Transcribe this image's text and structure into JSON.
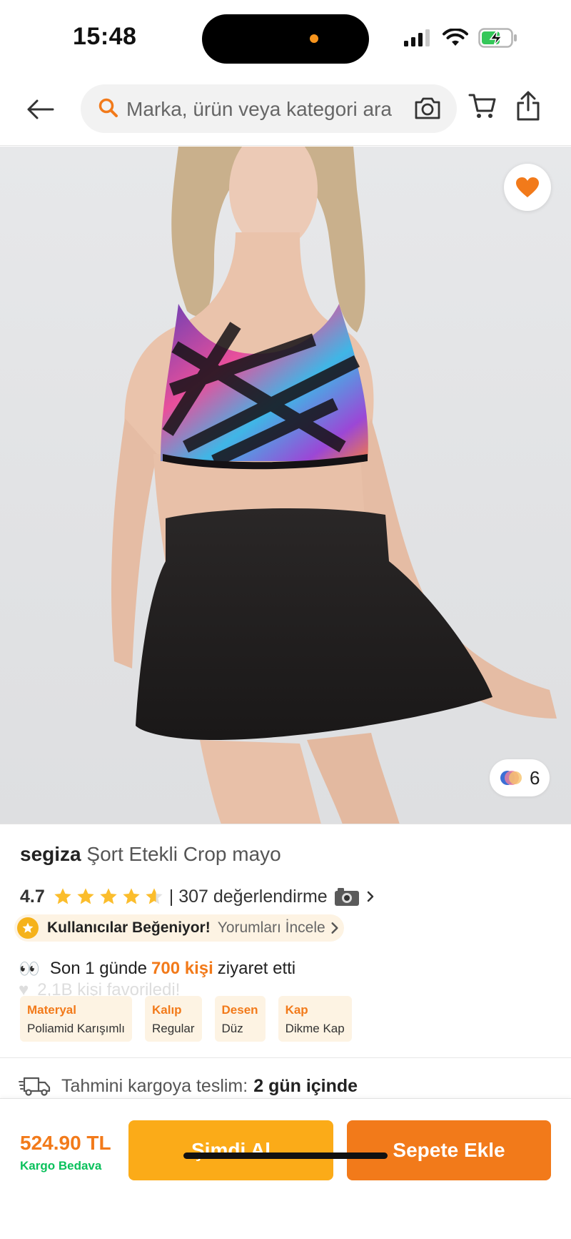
{
  "status_bar": {
    "time": "15:48"
  },
  "header": {
    "search_placeholder": "Marka, ürün veya kategori ara"
  },
  "product": {
    "brand": "segiza",
    "name": "Şort Etekli Crop mayo",
    "color_count": "6",
    "rating": "4.7",
    "stars": 4.5,
    "reviews_text": "| 307 değerlendirme",
    "liked_text": "Kullanıcılar Beğeniyor!",
    "liked_link": "Yorumları İncele",
    "visit_prefix": "Son 1 günde",
    "visit_highlight": "700 kişi",
    "visit_suffix": "ziyaret etti",
    "favorites_ghost": "2,1B kişi favoriledi!",
    "attributes": [
      {
        "key": "Materyal",
        "value": "Poliamid Karışımlı"
      },
      {
        "key": "Kalıp",
        "value": "Regular"
      },
      {
        "key": "Desen",
        "value": "Düz"
      },
      {
        "key": "Kap",
        "value": "Dikme Kap"
      }
    ],
    "delivery_label": "Tahmini kargoya teslim:",
    "delivery_value": "2 gün içinde"
  },
  "action_bar": {
    "price": "524.90 TL",
    "cargo": "Kargo Bedava",
    "buy_now": "Şimdi Al",
    "add_to_cart": "Sepete Ekle"
  },
  "colors": {
    "accent": "#f27a1a",
    "buy_button": "#fbab18",
    "cargo_green": "#0bc15c",
    "pill_bg": "#fdf3e3"
  }
}
